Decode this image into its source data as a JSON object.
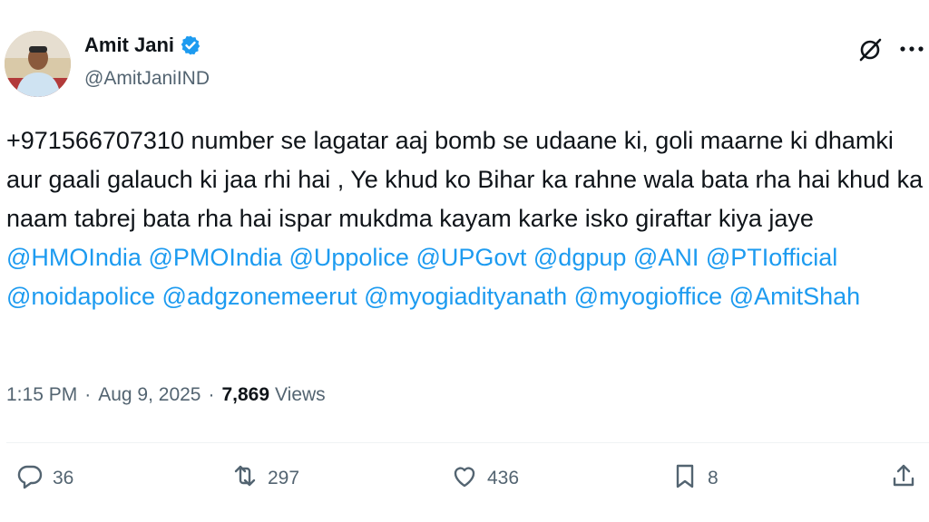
{
  "author": {
    "name": "Amit Jani",
    "handle": "@AmitJaniIND",
    "verified": true,
    "avatar_icon": "profile-photo"
  },
  "tweet": {
    "segments": [
      {
        "type": "text",
        "value": "+971566707310 number se lagatar aaj bomb se udaane ki, goli maarne ki dhamki aur gaali galauch ki jaa rhi hai , Ye khud ko Bihar ka rahne wala bata rha hai khud ka naam tabrej bata rha hai ispar mukdma kayam karke isko giraftar kiya jaye "
      },
      {
        "type": "mention",
        "value": "@HMOIndia"
      },
      {
        "type": "text",
        "value": " "
      },
      {
        "type": "mention",
        "value": "@PMOIndia"
      },
      {
        "type": "text",
        "value": " "
      },
      {
        "type": "mention",
        "value": "@Uppolice"
      },
      {
        "type": "text",
        "value": " "
      },
      {
        "type": "mention",
        "value": "@UPGovt"
      },
      {
        "type": "text",
        "value": " "
      },
      {
        "type": "mention",
        "value": "@dgpup"
      },
      {
        "type": "text",
        "value": " "
      },
      {
        "type": "mention",
        "value": "@ANI"
      },
      {
        "type": "text",
        "value": " "
      },
      {
        "type": "mention",
        "value": "@PTIofficial"
      },
      {
        "type": "text",
        "value": " "
      },
      {
        "type": "mention",
        "value": "@noidapolice"
      },
      {
        "type": "text",
        "value": " "
      },
      {
        "type": "mention",
        "value": "@adgzonemeerut"
      },
      {
        "type": "text",
        "value": " "
      },
      {
        "type": "mention",
        "value": "@myogiadityanath"
      },
      {
        "type": "text",
        "value": " "
      },
      {
        "type": "mention",
        "value": "@myogioffice"
      },
      {
        "type": "text",
        "value": " "
      },
      {
        "type": "mention",
        "value": "@AmitShah"
      }
    ]
  },
  "meta": {
    "time": "1:15 PM",
    "separator": "·",
    "date": "Aug 9, 2025",
    "views_count": "7,869",
    "views_label": "Views"
  },
  "actions": {
    "replies": "36",
    "reposts": "297",
    "likes": "436",
    "bookmarks": "8"
  },
  "colors": {
    "accent": "#1d9bf0",
    "text": "#0f1419",
    "secondary": "#536471"
  },
  "icons": {
    "header": [
      "grok-icon",
      "more-icon"
    ],
    "actions": [
      "reply-icon",
      "repost-icon",
      "like-icon",
      "bookmark-icon",
      "share-icon"
    ]
  }
}
